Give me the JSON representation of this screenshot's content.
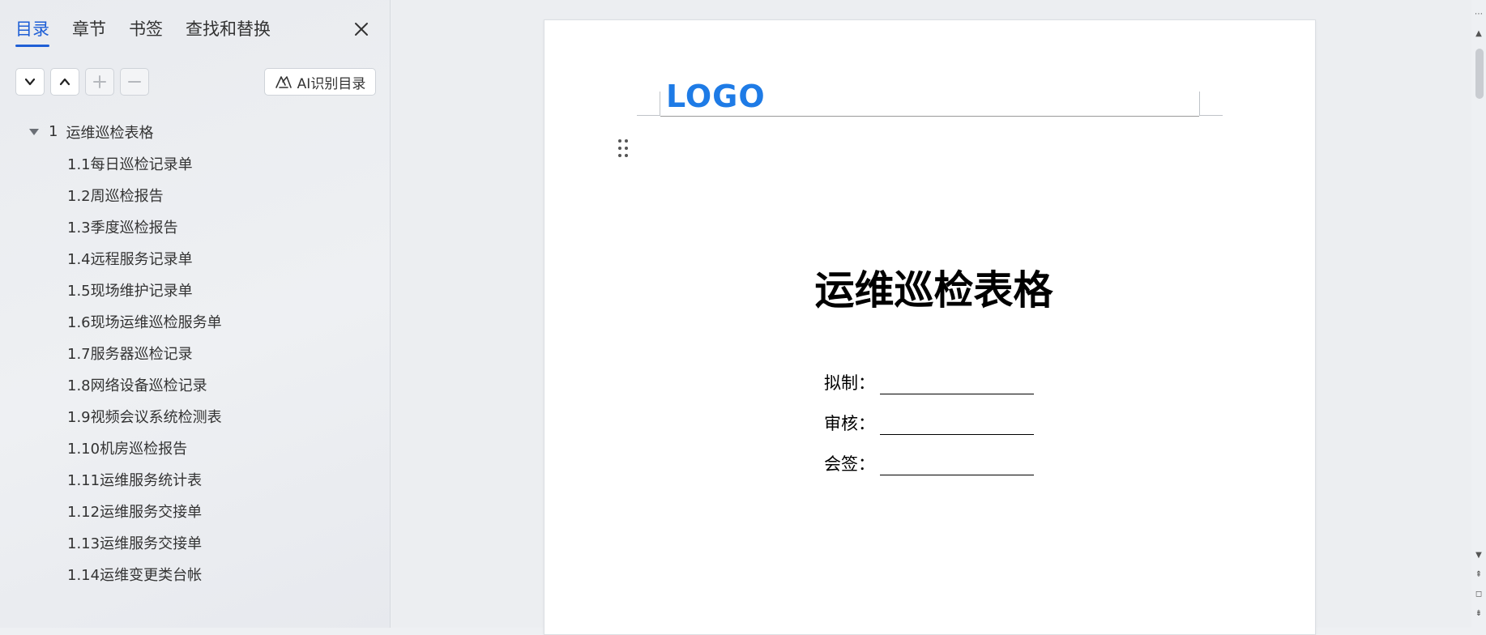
{
  "nav": {
    "tabs": [
      {
        "label": "目录",
        "active": true
      },
      {
        "label": "章节",
        "active": false
      },
      {
        "label": "书签",
        "active": false
      },
      {
        "label": "查找和替换",
        "active": false
      }
    ],
    "ai_button_label": "AI识别目录"
  },
  "toc": {
    "root": {
      "number": "1",
      "label": "运维巡检表格"
    },
    "items": [
      "1.1每日巡检记录单",
      "1.2周巡检报告",
      "1.3季度巡检报告",
      "1.4远程服务记录单",
      "1.5现场维护记录单",
      "1.6现场运维巡检服务单",
      "1.7服务器巡检记录",
      "1.8网络设备巡检记录",
      "1.9视频会议系统检测表",
      "1.10机房巡检报告",
      "1.11运维服务统计表",
      "1.12运维服务交接单",
      "1.13运维服务交接单",
      "1.14运维变更类台帐"
    ]
  },
  "document": {
    "logo_text": "LOGO",
    "title": "运维巡检表格",
    "fields": [
      {
        "label": "拟制："
      },
      {
        "label": "审核："
      },
      {
        "label": "会签："
      }
    ]
  },
  "colors": {
    "accent": "#1f5fd6",
    "logo": "#1e7be6"
  }
}
